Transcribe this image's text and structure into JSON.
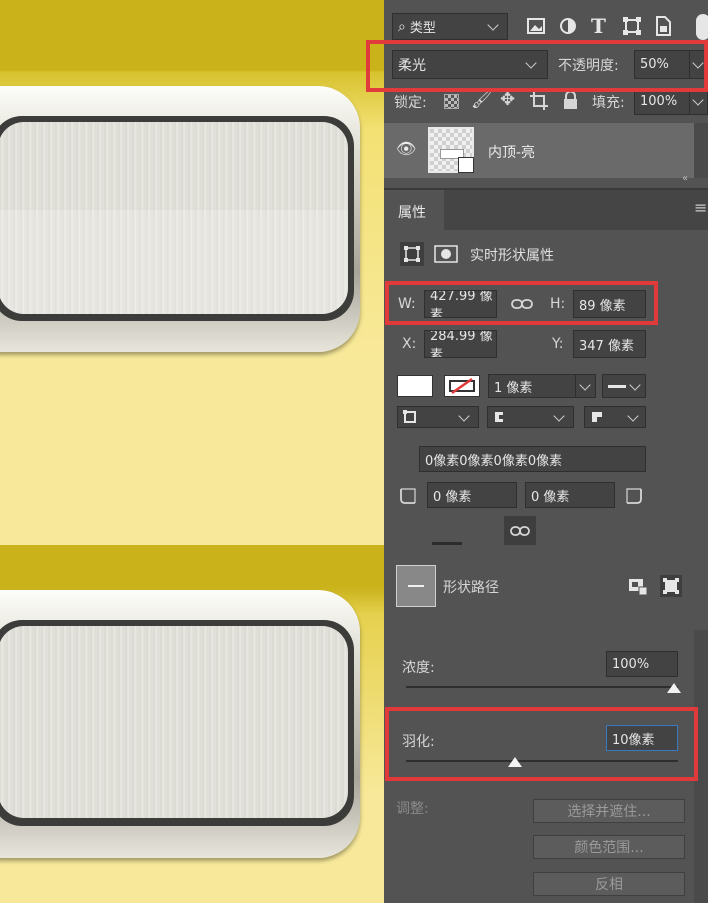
{
  "layers": {
    "filter_label": "类型",
    "blend_mode": "柔光",
    "opacity_label": "不透明度:",
    "opacity_value": "50%",
    "lock_label": "锁定:",
    "fill_label": "填充:",
    "fill_value": "100%",
    "layer_name": "内顶-亮"
  },
  "properties": {
    "tab_label": "属性",
    "live_shape_label": "实时形状属性",
    "w_label": "W:",
    "w_value": "427.99 像素",
    "h_label": "H:",
    "h_value": "89 像素",
    "x_label": "X:",
    "x_value": "284.99 像素",
    "y_label": "Y:",
    "y_value": "347 像素",
    "stroke_width": "1 像素",
    "corner_all": "0像素0像素0像素0像素",
    "corner_bl": "0 像素",
    "corner_br": "0 像素"
  },
  "mask": {
    "shape_path_label": "形状路径",
    "density_label": "浓度:",
    "density_value": "100%",
    "density_level": 1.0,
    "feather_label": "羽化:",
    "feather_value": "10像素",
    "feather_level": 0.4,
    "refine_label": "调整:",
    "select_mask_button": "选择并遮住...",
    "color_range_button": "颜色范围...",
    "invert_button": "反相"
  },
  "colors": {
    "highlight_red": "#e03a3a",
    "canvas_yellow_dark": "#c9b21a",
    "canvas_yellow_light": "#f8e99a",
    "panel_bg": "#535353"
  }
}
